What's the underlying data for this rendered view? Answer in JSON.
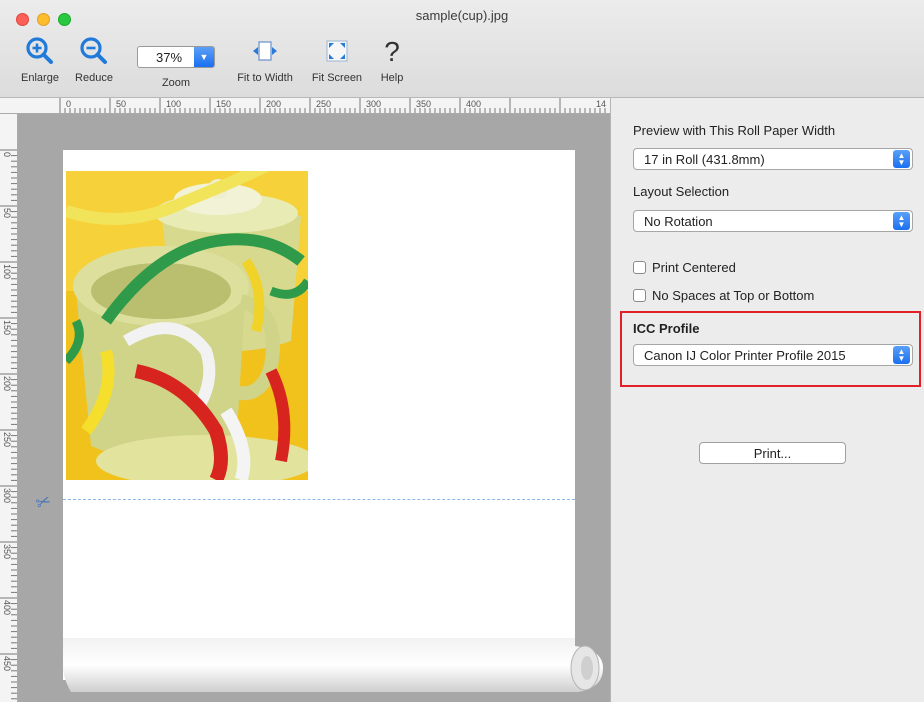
{
  "window": {
    "title": "sample(cup).jpg"
  },
  "toolbar": {
    "enlarge_label": "Enlarge",
    "reduce_label": "Reduce",
    "zoom_value": "37%",
    "zoom_label": "Zoom",
    "fit_width_label": "Fit to Width",
    "fit_screen_label": "Fit Screen",
    "help_label": "Help"
  },
  "ruler": {
    "horizontal": [
      "0",
      "50",
      "100",
      "150",
      "200",
      "250",
      "300",
      "350",
      "400",
      "14"
    ],
    "vertical": [
      "0",
      "50",
      "100",
      "150",
      "200",
      "250",
      "300",
      "350",
      "400",
      "450"
    ]
  },
  "panel": {
    "paper_width_label": "Preview with This Roll Paper Width",
    "paper_width_value": "17 in Roll (431.8mm)",
    "layout_label": "Layout Selection",
    "layout_value": "No Rotation",
    "print_centered_label": "Print Centered",
    "no_spaces_label": "No Spaces at Top or Bottom",
    "icc_label": "ICC Profile",
    "icc_value": "Canon IJ Color Printer Profile 2015",
    "print_button": "Print..."
  },
  "icons": {
    "enlarge": "zoom-in-icon",
    "reduce": "zoom-out-icon",
    "fit_width": "fit-width-icon",
    "fit_screen": "fit-screen-icon",
    "help": "help-icon",
    "cut": "scissors-icon"
  },
  "colors": {
    "accent": "#1b6ff0",
    "highlight": "#e2202a",
    "preview_bg": "#a7a7a7"
  }
}
